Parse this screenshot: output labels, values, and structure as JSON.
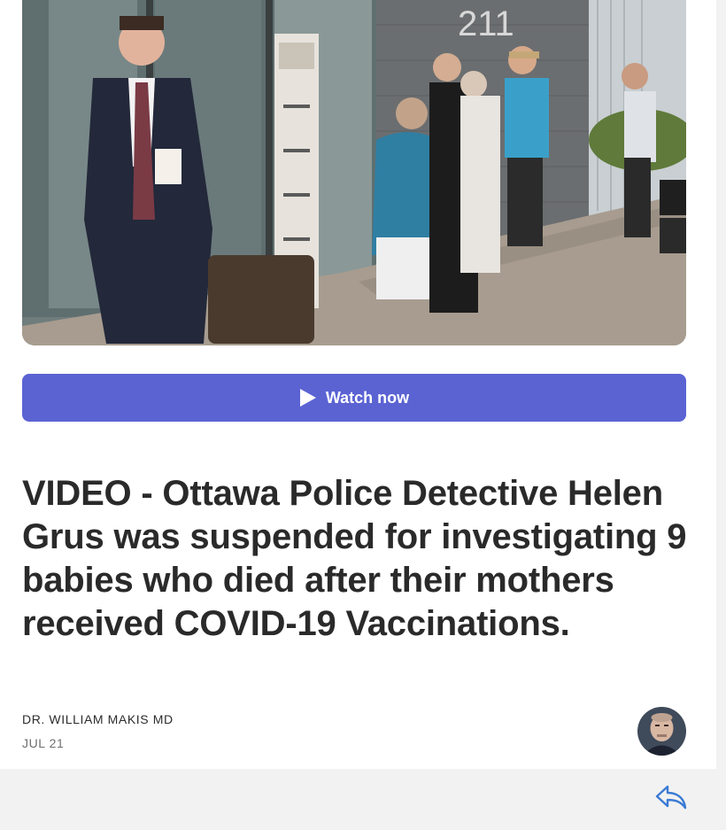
{
  "media": {
    "description_icon": "video-thumbnail",
    "building_number": "211"
  },
  "watch_button": {
    "icon": "play-icon",
    "label": "Watch now",
    "color": "#5b63d3"
  },
  "post": {
    "title": "VIDEO - Ottawa Police Detective Helen Grus was suspended for investigating 9 babies who died after their mothers received COVID-19 Vaccinations.",
    "author": "DR. WILLIAM MAKIS MD",
    "date": "JUL 21"
  },
  "footer": {
    "share_icon": "share-reply-icon",
    "accent": "#3b7bd4"
  }
}
